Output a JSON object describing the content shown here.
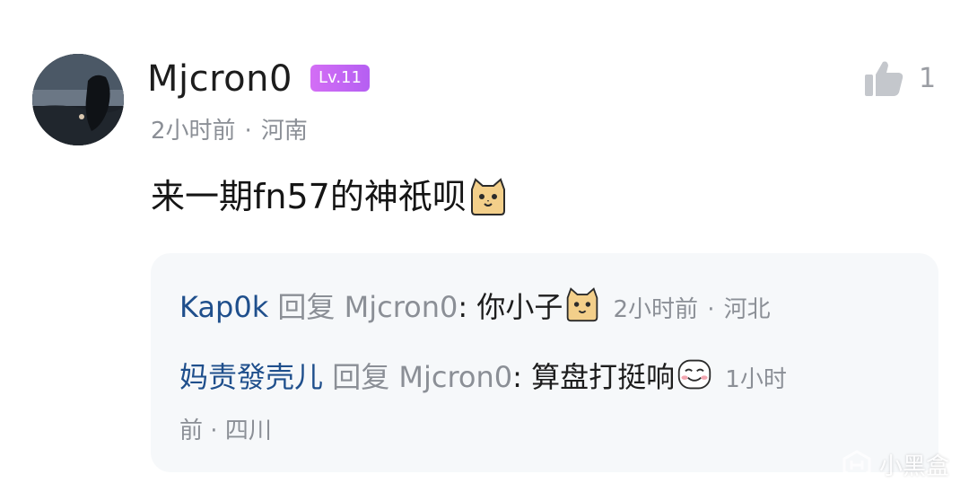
{
  "comment": {
    "username": "Mjcron0",
    "level": "Lv.11",
    "time": "2小时前",
    "location": "河南",
    "meta_separator": "·",
    "text": "来一期fn57的神祇呗",
    "emoji": "cat-face-emoji",
    "likes": "1"
  },
  "replies": [
    {
      "author": "Kap0k",
      "reply_word": "回复",
      "target": "Mjcron0",
      "colon": ":",
      "content": "你小子",
      "emoji": "cat-face-emoji",
      "time": "2小时前",
      "separator": "·",
      "location": "河北"
    },
    {
      "author": "妈责發壳儿",
      "reply_word": "回复",
      "target": "Mjcron0",
      "colon": ":",
      "content": "算盘打挺响",
      "emoji": "blushing-smile-emoji",
      "time_part1": "1小时",
      "time_part2": "前",
      "separator": "·",
      "location": "四川"
    }
  ],
  "watermark": {
    "text": "小黑盒",
    "icon": "xiaoheihe-logo"
  },
  "colors": {
    "level_badge": "#c466f4",
    "author_link": "#1f4f8c",
    "meta_gray": "#8b8f96",
    "reply_box_bg": "#f6f8fa"
  }
}
